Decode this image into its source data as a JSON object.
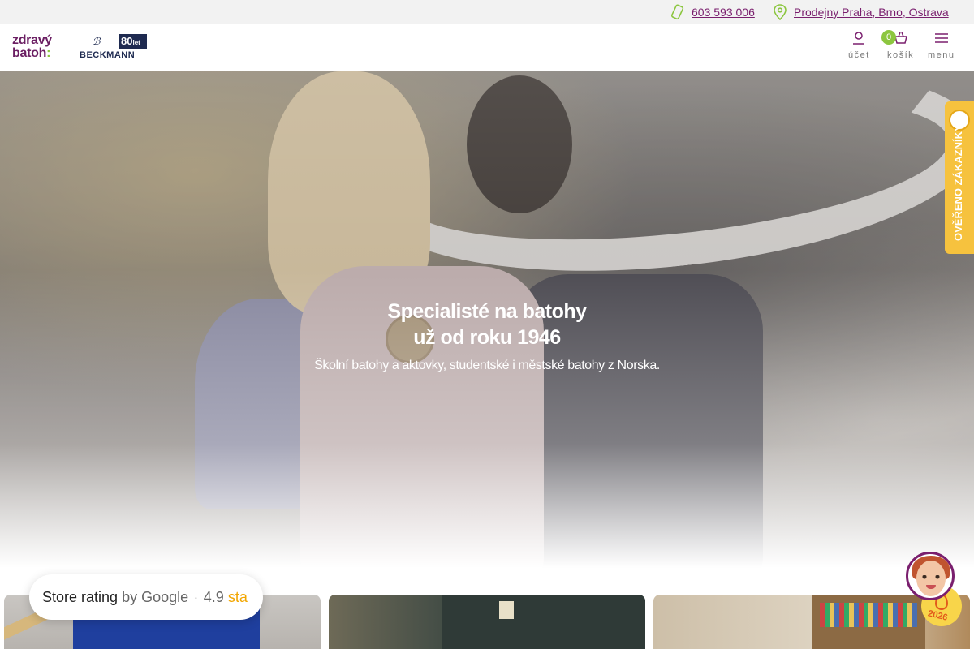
{
  "topbar": {
    "phone": "603 593 006",
    "stores": "Prodejny Praha, Brno, Ostrava"
  },
  "header": {
    "logo_line1": "zdravý",
    "logo_line2": "batoh",
    "partner_years": "80",
    "partner_years_suffix": "let",
    "partner_name": "BECKMANN",
    "account_label": "účet",
    "cart_label": "košík",
    "cart_count": "0",
    "menu_label": "menu"
  },
  "hero": {
    "title_line1": "Specialisté na batohy",
    "title_line2": "už od roku 1946",
    "subtitle": "Školní batohy a aktovky, studentské i městské batohy z Norska."
  },
  "verified_badge": {
    "label": "OVĚŘENO ZÁKAZNÍKY"
  },
  "rating": {
    "label": "Store rating",
    "by": "by Google",
    "separator": "·",
    "score": "4.9",
    "stars": "sta"
  },
  "promo_badge": {
    "year": "2026"
  },
  "colors": {
    "brand_purple": "#7a1f6e",
    "accent_green": "#8cc63f",
    "badge_yellow": "#f6c23e",
    "navy": "#1e2a50"
  }
}
